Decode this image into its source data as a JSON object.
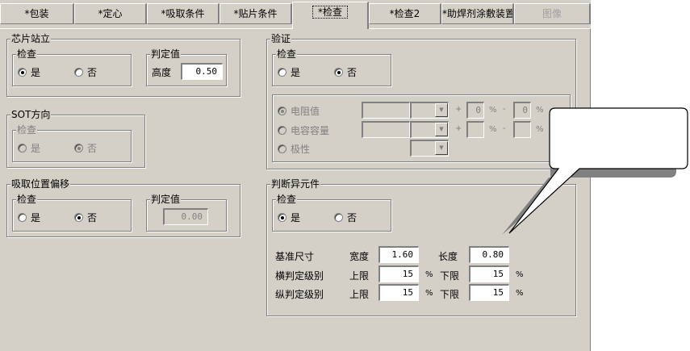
{
  "tabs": [
    {
      "label": "*包装"
    },
    {
      "label": "*定心"
    },
    {
      "label": "*吸取条件"
    },
    {
      "label": "*贴片条件"
    },
    {
      "label": "*检查"
    },
    {
      "label": "*检查2"
    },
    {
      "label": "*助焊剂涂敷装置"
    },
    {
      "label": "图像"
    }
  ],
  "chip_standing": {
    "title": "芯片站立",
    "check_title": "检查",
    "yes": "是",
    "no": "否",
    "judge_title": "判定值",
    "height_label": "高度",
    "height_value": "0.50"
  },
  "sot": {
    "title": "SOT方向",
    "check_title": "检查",
    "yes": "是",
    "no": "否"
  },
  "pickup_offset": {
    "title": "吸取位置偏移",
    "check_title": "检查",
    "yes": "是",
    "no": "否",
    "judge_title": "判定值",
    "value": "0.00"
  },
  "verify": {
    "title": "验证",
    "check_title": "检查",
    "yes": "是",
    "no": "否",
    "resistance_label": "电阻值",
    "capacitance_label": "电容容量",
    "polarity_label": "极性",
    "plus": "+",
    "minus": "-",
    "percent": "%",
    "tol_plus": "0",
    "tol_minus": "0"
  },
  "odd_part": {
    "title": "判断异元件",
    "check_title": "检查",
    "yes": "是",
    "no": "否",
    "ref_size": "基准尺寸",
    "width_label": "宽度",
    "width_value": "1.60",
    "length_label": "长度",
    "length_value": "0.80",
    "horiz_label": "横判定级别",
    "vert_label": "纵判定级别",
    "upper_label": "上限",
    "lower_label": "下限",
    "percent": "%",
    "horiz_upper": "15",
    "horiz_lower": "15",
    "vert_upper": "15",
    "vert_lower": "15"
  },
  "callout": {
    "text": ""
  }
}
